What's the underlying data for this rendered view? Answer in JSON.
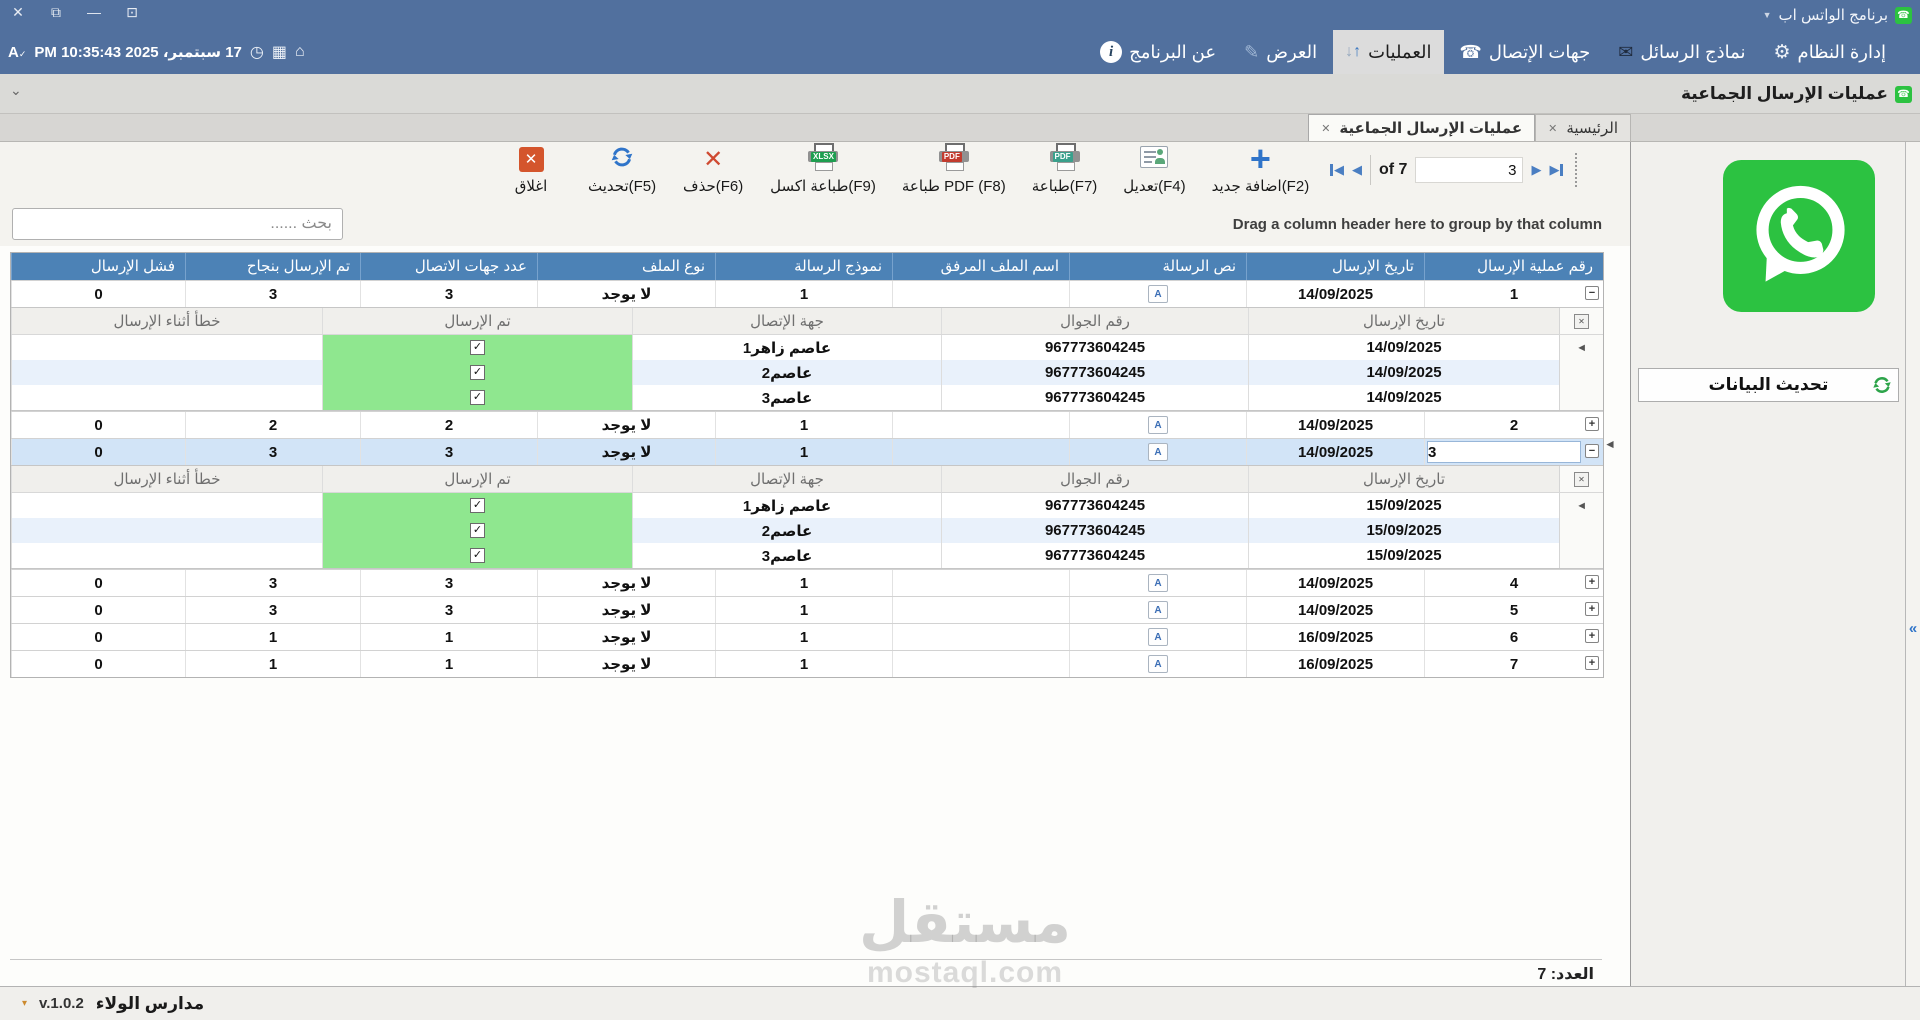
{
  "window": {
    "title": "برنامج الواتس اب",
    "controls": [
      "close-icon",
      "restore-icon",
      "minimize-icon",
      "pin-window-icon"
    ]
  },
  "menu": {
    "datetime": "17 سبتمبر، 2025 10:35:43 PM",
    "status_icons": [
      "language-icon",
      "clock-icon",
      "calculator-icon",
      "home-icon"
    ],
    "items": [
      {
        "label": "إدارة النظام",
        "icon": "gears-icon",
        "selected": false
      },
      {
        "label": "نماذج الرسائل",
        "icon": "envelope-icon",
        "selected": false
      },
      {
        "label": "جهات الإتصال",
        "icon": "phone-icon",
        "selected": false
      },
      {
        "label": "العمليات",
        "icon": "sort-arrows-icon",
        "selected": true
      },
      {
        "label": "العرض",
        "icon": "pencil-icon",
        "selected": false
      },
      {
        "label": "عن البرنامج",
        "icon": "info-icon",
        "selected": false
      }
    ]
  },
  "subheader": {
    "title": "عمليات الإرسال الجماعية"
  },
  "tabs": [
    {
      "label": "الرئيسية",
      "active": false
    },
    {
      "label": "عمليات الإرسال الجماعية",
      "active": true
    }
  ],
  "toolbar": {
    "buttons": [
      {
        "label": "اغلاق",
        "icon": "close-box-icon"
      },
      {
        "label": "تحديث(F5)",
        "icon": "refresh-icon"
      },
      {
        "label": "حذف(F6)",
        "icon": "delete-icon"
      },
      {
        "label": "طباعة اكسل(F9)",
        "icon": "print-excel-icon"
      },
      {
        "label": "طباعة PDF (F8)",
        "icon": "print-pdf-icon"
      },
      {
        "label": "طباعة(F7)",
        "icon": "printer-icon"
      },
      {
        "label": "تعديل(F4)",
        "icon": "edit-icon"
      },
      {
        "label": "اضافة جديد(F2)",
        "icon": "add-icon"
      }
    ],
    "nav": {
      "of_label": "of 7",
      "value": "3"
    }
  },
  "search": {
    "placeholder": "بحث ......"
  },
  "grid": {
    "drag_hint": "Drag a column header here to group by that column",
    "columns": [
      "رقم عملية الإرسال",
      "تاريخ الإرسال",
      "نص الرسالة",
      "اسم الملف المرفق",
      "نموذج الرسالة",
      "نوع الملف",
      "عدد جهات الاتصال",
      "تم الإرسال بنجاح",
      "فشل الإرسال"
    ],
    "detail_columns": [
      "تاريخ الإرسال",
      "رقم الجوال",
      "جهة الإتصال",
      "تم الإرسال",
      "خطأ أثناء الإرسال"
    ],
    "rows": [
      {
        "id": "1",
        "date": "14/09/2025",
        "message_icon": "text-message-icon",
        "attachment": "",
        "template": "1",
        "file_type": "لا يوجد",
        "contacts": "3",
        "sent_ok": "3",
        "failed": "0",
        "expanded": true,
        "selected": false,
        "details": [
          {
            "date": "14/09/2025",
            "mobile": "967773604245",
            "contact": "عاصم زاهر1",
            "sent": true,
            "error": ""
          },
          {
            "date": "14/09/2025",
            "mobile": "967773604245",
            "contact": "عاصم2",
            "sent": true,
            "error": ""
          },
          {
            "date": "14/09/2025",
            "mobile": "967773604245",
            "contact": "عاصم3",
            "sent": true,
            "error": ""
          }
        ]
      },
      {
        "id": "2",
        "date": "14/09/2025",
        "message_icon": "text-message-icon",
        "attachment": "",
        "template": "1",
        "file_type": "لا يوجد",
        "contacts": "2",
        "sent_ok": "2",
        "failed": "0",
        "expanded": false,
        "selected": false,
        "details": []
      },
      {
        "id": "3",
        "date": "14/09/2025",
        "message_icon": "text-message-icon",
        "attachment": "",
        "template": "1",
        "file_type": "لا يوجد",
        "contacts": "3",
        "sent_ok": "3",
        "failed": "0",
        "expanded": true,
        "selected": true,
        "details": [
          {
            "date": "15/09/2025",
            "mobile": "967773604245",
            "contact": "عاصم زاهر1",
            "sent": true,
            "error": ""
          },
          {
            "date": "15/09/2025",
            "mobile": "967773604245",
            "contact": "عاصم2",
            "sent": true,
            "error": ""
          },
          {
            "date": "15/09/2025",
            "mobile": "967773604245",
            "contact": "عاصم3",
            "sent": true,
            "error": ""
          }
        ]
      },
      {
        "id": "4",
        "date": "14/09/2025",
        "message_icon": "text-message-icon",
        "attachment": "",
        "template": "1",
        "file_type": "لا يوجد",
        "contacts": "3",
        "sent_ok": "3",
        "failed": "0",
        "expanded": false,
        "selected": false,
        "details": []
      },
      {
        "id": "5",
        "date": "14/09/2025",
        "message_icon": "text-message-icon",
        "attachment": "",
        "template": "1",
        "file_type": "لا يوجد",
        "contacts": "3",
        "sent_ok": "3",
        "failed": "0",
        "expanded": false,
        "selected": false,
        "details": []
      },
      {
        "id": "6",
        "date": "16/09/2025",
        "message_icon": "text-message-icon",
        "attachment": "",
        "template": "1",
        "file_type": "لا يوجد",
        "contacts": "1",
        "sent_ok": "1",
        "failed": "0",
        "expanded": false,
        "selected": false,
        "details": []
      },
      {
        "id": "7",
        "date": "16/09/2025",
        "message_icon": "text-message-icon",
        "attachment": "",
        "template": "1",
        "file_type": "لا يوجد",
        "contacts": "1",
        "sent_ok": "1",
        "failed": "0",
        "expanded": false,
        "selected": false,
        "details": []
      }
    ],
    "footer_count": "العدد: 7"
  },
  "sidebar": {
    "logo": "whatsapp-logo",
    "refresh_label": "تحديث البيانات"
  },
  "right_strip": {
    "collapse_glyph": "«"
  },
  "statusbar": {
    "app_name": "مدارس الولاء",
    "version": "v.1.0.2"
  },
  "watermark": {
    "line1": "مستقل",
    "line2": "mostaql.com"
  },
  "colors": {
    "titlebar": "#51709e",
    "grid_header": "#4c82b6",
    "whatsapp_green": "#2cc241",
    "success_green": "#8fe78f",
    "selected_row": "#d2e4f7"
  }
}
